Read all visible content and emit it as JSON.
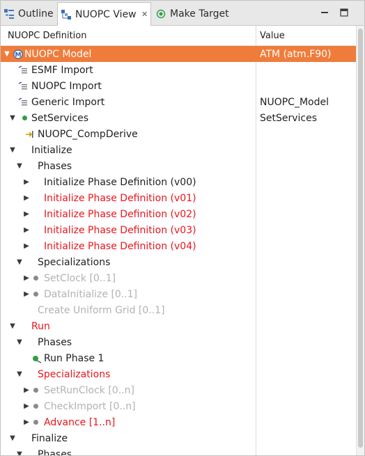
{
  "tabs": [
    {
      "label": "Outline",
      "icon": "outline-icon"
    },
    {
      "label": "NUOPC View",
      "icon": "nuopc-view-icon",
      "active": true
    },
    {
      "label": "Make Target",
      "icon": "make-target-icon"
    }
  ],
  "columns": {
    "definition": "NUOPC Definition",
    "value": "Value"
  },
  "colors": {
    "selection": "#f07c3b",
    "required": "#e8141c",
    "disabled": "#b2b2b2",
    "dot_green": "#2f9e44",
    "dot_gray": "#8a8a8a"
  },
  "rows": [
    {
      "label": "NUOPC Model",
      "value": "ATM (atm.F90)"
    },
    {
      "label": "ESMF Import",
      "value": ""
    },
    {
      "label": "NUOPC Import",
      "value": ""
    },
    {
      "label": "Generic Import",
      "value": "NUOPC_Model"
    },
    {
      "label": "SetServices",
      "value": "SetServices"
    },
    {
      "label": "NUOPC_CompDerive",
      "value": ""
    },
    {
      "label": "Initialize",
      "value": ""
    },
    {
      "label": "Phases",
      "value": ""
    },
    {
      "label": "Initialize Phase Definition (v00)",
      "value": ""
    },
    {
      "label": "Initialize Phase Definition (v01)",
      "value": ""
    },
    {
      "label": "Initialize Phase Definition (v02)",
      "value": ""
    },
    {
      "label": "Initialize Phase Definition (v03)",
      "value": ""
    },
    {
      "label": "Initialize Phase Definition (v04)",
      "value": ""
    },
    {
      "label": "Specializations",
      "value": ""
    },
    {
      "label": "SetClock [0..1]",
      "value": ""
    },
    {
      "label": "DataInitialize [0..1]",
      "value": ""
    },
    {
      "label": "Create Uniform Grid [0..1]",
      "value": ""
    },
    {
      "label": "Run",
      "value": ""
    },
    {
      "label": "Phases",
      "value": ""
    },
    {
      "label": "Run Phase 1",
      "value": ""
    },
    {
      "label": "Specializations",
      "value": ""
    },
    {
      "label": "SetRunClock [0..n]",
      "value": ""
    },
    {
      "label": "CheckImport [0..n]",
      "value": ""
    },
    {
      "label": "Advance [1..n]",
      "value": ""
    },
    {
      "label": "Finalize",
      "value": ""
    },
    {
      "label": "Phases",
      "value": ""
    }
  ]
}
